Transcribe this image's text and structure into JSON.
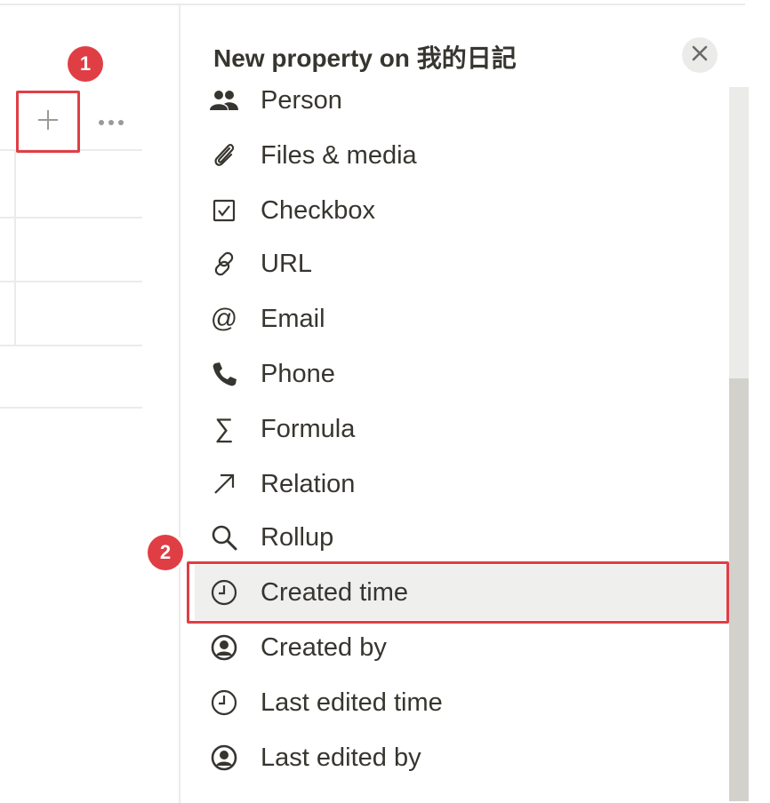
{
  "panel": {
    "title": "New property on 我的日記",
    "close_icon": "close-icon"
  },
  "table": {
    "add_column_icon": "plus-icon",
    "more_icon": "ellipsis-icon"
  },
  "annotations": {
    "step1": "1",
    "step2": "2",
    "color": "#e03e45"
  },
  "property_types": [
    {
      "label": "Person",
      "icon": "people-icon"
    },
    {
      "label": "Files & media",
      "icon": "paperclip-icon"
    },
    {
      "label": "Checkbox",
      "icon": "checkbox-icon"
    },
    {
      "label": "URL",
      "icon": "link-icon"
    },
    {
      "label": "Email",
      "icon": "at-sign-icon"
    },
    {
      "label": "Phone",
      "icon": "phone-icon"
    },
    {
      "label": "Formula",
      "icon": "sigma-icon"
    },
    {
      "label": "Relation",
      "icon": "arrow-up-right-icon"
    },
    {
      "label": "Rollup",
      "icon": "magnifier-icon"
    },
    {
      "label": "Created time",
      "icon": "clock-icon",
      "highlighted": true
    },
    {
      "label": "Created by",
      "icon": "user-circle-icon"
    },
    {
      "label": "Last edited time",
      "icon": "clock-icon"
    },
    {
      "label": "Last edited by",
      "icon": "user-circle-icon"
    }
  ]
}
